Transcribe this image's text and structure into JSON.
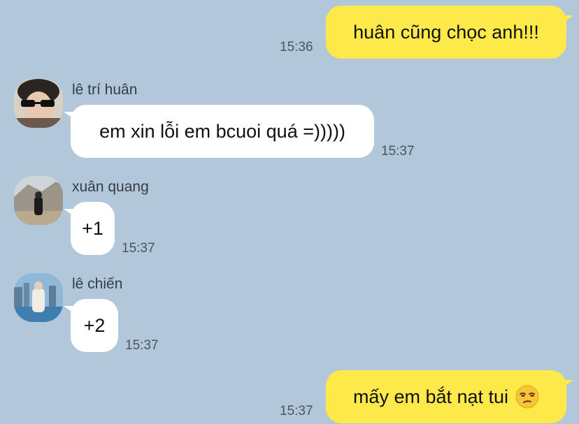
{
  "messages": [
    {
      "from": "me",
      "text": "huân cũng chọc anh!!!",
      "time": "15:36"
    },
    {
      "from": "lê trí huân",
      "text": "em xin lỗi em bcuoi quá =)))))",
      "time": "15:37",
      "avatar_icon": "avatar-photo-huan"
    },
    {
      "from": "xuân quang",
      "text": "+1",
      "time": "15:37",
      "avatar_icon": "avatar-photo-quang"
    },
    {
      "from": "lê chiến",
      "text": "+2",
      "time": "15:37",
      "avatar_icon": "avatar-photo-chien"
    },
    {
      "from": "me",
      "text": "mấy em bắt nạt tui",
      "emoji": "unamused-face-emoji",
      "time": "15:37"
    }
  ],
  "colors": {
    "background": "#b2c7d9",
    "outgoing_bubble": "#fde94a",
    "incoming_bubble": "#ffffff"
  }
}
